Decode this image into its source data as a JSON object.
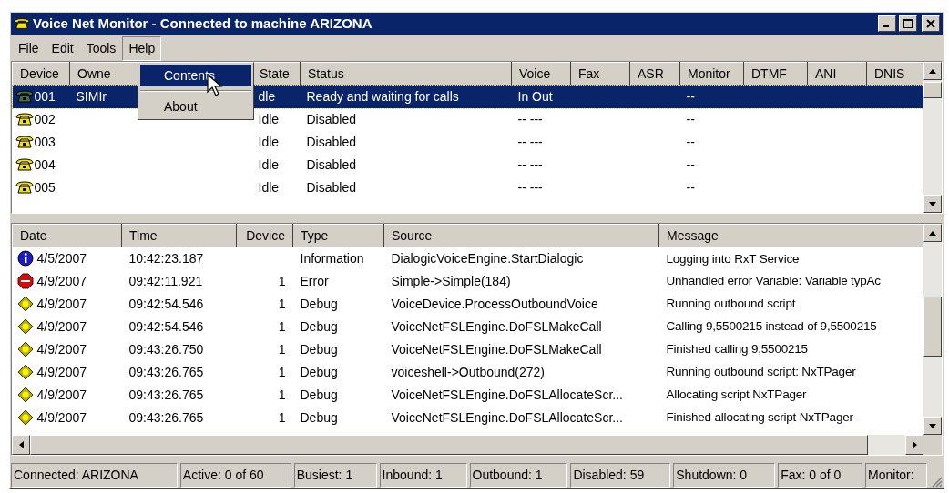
{
  "window": {
    "title": "Voice Net Monitor - Connected to machine ARIZONA"
  },
  "menu": [
    {
      "label": "File",
      "open": false
    },
    {
      "label": "Edit",
      "open": false
    },
    {
      "label": "Tools",
      "open": false
    },
    {
      "label": "Help",
      "open": true
    }
  ],
  "dropdown": [
    {
      "kind": "item",
      "label": "Contents",
      "selected": true
    },
    {
      "kind": "separator"
    },
    {
      "kind": "item",
      "label": "About",
      "selected": false
    }
  ],
  "devices": {
    "columns": [
      "Device",
      "Owne",
      "State",
      "Status",
      "Voice",
      "Fax",
      "ASR",
      "Monitor",
      "DTMF",
      "ANI",
      "DNIS"
    ],
    "rows": [
      {
        "selected": true,
        "cells": [
          "001",
          "SIMIr",
          "dle",
          "Ready and waiting for calls",
          "In Out",
          "",
          "",
          "--",
          "",
          "",
          ""
        ]
      },
      {
        "selected": false,
        "cells": [
          "002",
          "",
          "Idle",
          "Disabled",
          "-- ---",
          "",
          "",
          "--",
          "",
          "",
          ""
        ]
      },
      {
        "selected": false,
        "cells": [
          "003",
          "",
          "Idle",
          "Disabled",
          "-- ---",
          "",
          "",
          "--",
          "",
          "",
          ""
        ]
      },
      {
        "selected": false,
        "cells": [
          "004",
          "",
          "Idle",
          "Disabled",
          "-- ---",
          "",
          "",
          "--",
          "",
          "",
          ""
        ]
      },
      {
        "selected": false,
        "cells": [
          "005",
          "",
          "Idle",
          "Disabled",
          "-- ---",
          "",
          "",
          "--",
          "",
          "",
          ""
        ]
      }
    ]
  },
  "log": {
    "columns": [
      "Date",
      "Time",
      "Device",
      "Type",
      "Source",
      "Message"
    ],
    "rows": [
      {
        "kind": "information",
        "date": "4/5/2007",
        "time": "10:42:23.187",
        "device": "",
        "type": "Information",
        "source": "DialogicVoiceEngine.StartDialogic",
        "message": "Logging into RxT Service"
      },
      {
        "kind": "error",
        "date": "4/9/2007",
        "time": "09:42:11.921",
        "device": "1",
        "type": "Error",
        "source": "Simple->Simple(184)",
        "message": "Unhandled error Variable: Variable typAc"
      },
      {
        "kind": "debug",
        "date": "4/9/2007",
        "time": "09:42:54.546",
        "device": "1",
        "type": "Debug",
        "source": "VoiceDevice.ProcessOutboundVoice",
        "message": "Running outbound script"
      },
      {
        "kind": "debug",
        "date": "4/9/2007",
        "time": "09:42:54.546",
        "device": "1",
        "type": "Debug",
        "source": "VoiceNetFSLEngine.DoFSLMakeCall",
        "message": "Calling 9,5500215 instead of 9,5500215"
      },
      {
        "kind": "debug",
        "date": "4/9/2007",
        "time": "09:43:26.750",
        "device": "1",
        "type": "Debug",
        "source": "VoiceNetFSLEngine.DoFSLMakeCall",
        "message": "Finished calling 9,5500215"
      },
      {
        "kind": "debug",
        "date": "4/9/2007",
        "time": "09:43:26.765",
        "device": "1",
        "type": "Debug",
        "source": "voiceshell->Outbound(272)",
        "message": "Running outbound script: NxTPager"
      },
      {
        "kind": "debug",
        "date": "4/9/2007",
        "time": "09:43:26.765",
        "device": "1",
        "type": "Debug",
        "source": "VoiceNetFSLEngine.DoFSLAllocateScr...",
        "message": "Allocating script NxTPager"
      },
      {
        "kind": "debug",
        "date": "4/9/2007",
        "time": "09:43:26.765",
        "device": "1",
        "type": "Debug",
        "source": "VoiceNetFSLEngine.DoFSLAllocateScr...",
        "message": "Finished allocating script NxTPager"
      }
    ]
  },
  "status_bar": [
    "Connected: ARIZONA",
    "Active: 0 of 60",
    "Busiest: 1",
    "Inbound: 1",
    "Outbound: 1",
    "Disabled: 59",
    "Shutdown: 0",
    "Fax: 0 of 0",
    "Monitor:"
  ]
}
